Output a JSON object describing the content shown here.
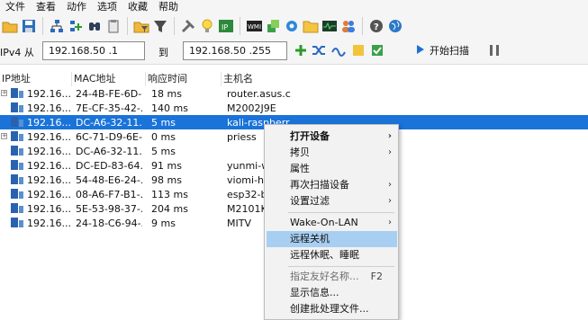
{
  "menu": [
    "文件",
    "查看",
    "动作",
    "选项",
    "收藏",
    "帮助"
  ],
  "toolbar_icons": [
    "folder-open-icon",
    "save-icon",
    "network-tree-icon",
    "add-network-icon",
    "binoculars-icon",
    "clipboard-icon",
    "folder-filter-icon",
    "filter-icon",
    "tools-icon",
    "lightbulb-icon",
    "ip-icon",
    "wmi-icon",
    "cube-icon",
    "gear-icon",
    "folder-icon",
    "monitor-icon",
    "users-icon",
    "help-icon",
    "globe-icon"
  ],
  "range": {
    "label_from": "IPv4 从",
    "from_value": "192.168.50 .1",
    "label_to": "到",
    "to_value": "192.168.50 .255",
    "start_label": "开始扫描"
  },
  "columns": [
    "IP地址",
    "MAC地址",
    "响应时间",
    "主机名"
  ],
  "rows": [
    {
      "ip": "192.16...",
      "mac": "24-4B-FE-6D-...",
      "rt": "18 ms",
      "host": "router.asus.c...",
      "expander": true,
      "selected": false
    },
    {
      "ip": "192.16...",
      "mac": "7E-CF-35-42-...",
      "rt": "140 ms",
      "host": "M2002J9E",
      "expander": false,
      "selected": false
    },
    {
      "ip": "192.16...",
      "mac": "DC-A6-32-11...",
      "rt": "5 ms",
      "host": "kali-raspberr...",
      "expander": false,
      "selected": true
    },
    {
      "ip": "192.16...",
      "mac": "6C-71-D9-6E-...",
      "rt": "0 ms",
      "host": "priess",
      "expander": true,
      "selected": false
    },
    {
      "ip": "192.16...",
      "mac": "DC-A6-32-11...",
      "rt": "5 ms",
      "host": "",
      "expander": false,
      "selected": false
    },
    {
      "ip": "192.16...",
      "mac": "DC-ED-83-64...",
      "rt": "91 ms",
      "host": "yunmi-w",
      "expander": false,
      "selected": false
    },
    {
      "ip": "192.16...",
      "mac": "54-48-E6-24-...",
      "rt": "98 ms",
      "host": "viomi-hc",
      "expander": false,
      "selected": false
    },
    {
      "ip": "192.16...",
      "mac": "08-A6-F7-B1-...",
      "rt": "113 ms",
      "host": "esp32-b",
      "expander": false,
      "selected": false
    },
    {
      "ip": "192.16...",
      "mac": "5E-53-98-37-...",
      "rt": "204 ms",
      "host": "M2101K",
      "expander": false,
      "selected": false
    },
    {
      "ip": "192.16...",
      "mac": "24-18-C6-94-...",
      "rt": "9 ms",
      "host": "MITV",
      "expander": false,
      "selected": false
    }
  ],
  "context_menu": [
    {
      "label": "打开设备",
      "bold": true,
      "submenu": true
    },
    {
      "label": "拷贝",
      "submenu": true
    },
    {
      "label": "属性"
    },
    {
      "label": "再次扫描设备",
      "submenu": true
    },
    {
      "label": "设置过滤",
      "submenu": true
    },
    {
      "divider": true
    },
    {
      "label": "Wake-On-LAN",
      "submenu": true
    },
    {
      "label": "远程关机",
      "highlighted": true
    },
    {
      "label": "远程休眠、睡眠"
    },
    {
      "divider": true
    },
    {
      "label": "指定友好名称...",
      "shortcut": "F2",
      "disabled": true
    },
    {
      "label": "显示信息..."
    },
    {
      "label": "创建批处理文件..."
    }
  ],
  "colors": {
    "selection": "#1a73d9",
    "menu_highlight": "#a8cff2",
    "accent": "#1f6fd1"
  }
}
